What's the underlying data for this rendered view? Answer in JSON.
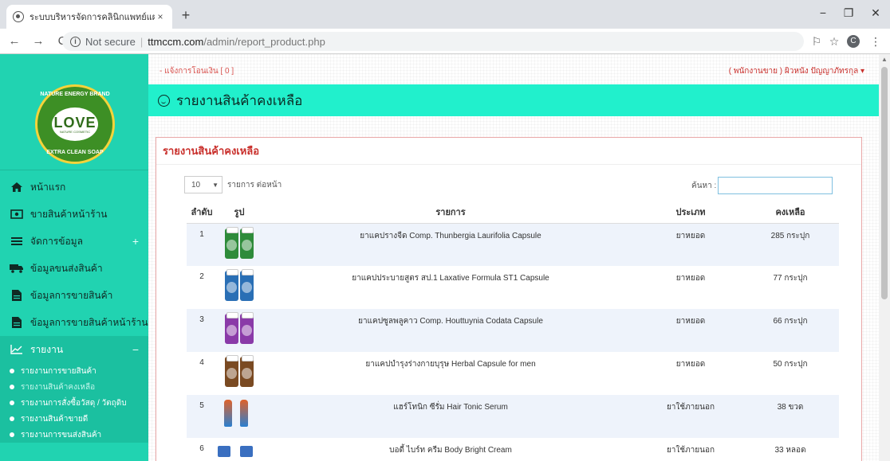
{
  "browser": {
    "tab_title": "ระบบบริหารจัดการคลินิกแพทย์แผนไทย",
    "tab_close": "×",
    "new_tab": "+",
    "minimize": "−",
    "maximize": "❐",
    "close": "✕",
    "back": "←",
    "forward": "→",
    "reload": "C",
    "not_secure": "Not secure",
    "url_domain": "ttmccm.com",
    "url_path": "/admin/report_product.php",
    "profile_initial": "C",
    "star": "☆",
    "translate": "⚐",
    "more": "⋮"
  },
  "sidebar": {
    "logo": {
      "top_text": "NATURE ENERGY BRAND",
      "brand": "LOVE",
      "sub": "NATURE COSMETIC",
      "bottom_text": "EXTRA CLEAN SOAP"
    },
    "items": [
      {
        "label": "หน้าแรก",
        "icon": "home-icon"
      },
      {
        "label": "ขายสินค้าหน้าร้าน",
        "icon": "cash-icon"
      },
      {
        "label": "จัดการข้อมูล",
        "icon": "list-icon",
        "toggle": "+"
      },
      {
        "label": "ข้อมูลขนส่งสินค้า",
        "icon": "truck-icon"
      },
      {
        "label": "ข้อมูลการขายสินค้า",
        "icon": "file-icon"
      },
      {
        "label": "ข้อมูลการขายสินค้าหน้าร้าน",
        "icon": "file-icon"
      },
      {
        "label": "รายงาน",
        "icon": "chart-icon",
        "toggle": "−"
      }
    ],
    "sub_items": [
      "รายงานการขายสินค้า",
      "รายงานสินค้าคงเหลือ",
      "รายงานการสั่งซื้อวัสดุ / วัตถุดิบ",
      "รายงานสินค้าขายดี",
      "รายงานการขนส่งสินค้า"
    ]
  },
  "topbar": {
    "notice": "- แจ้งการโอนเงิน [ 0 ]",
    "user": "( พนักงานขาย ) ผิวหนัง ปัญญาภัทรกุล ▾"
  },
  "page": {
    "header_title": "รายงานสินค้าคงเหลือ",
    "panel_title": "รายงานสินค้าคงเหลือ",
    "per_page_value": "10",
    "per_page_label": "รายการ ต่อหน้า",
    "search_label": "ค้นหา :",
    "search_value": ""
  },
  "table": {
    "headers": [
      "ลำดับ",
      "รูป",
      "รายการ",
      "ประเภท",
      "คงเหลือ"
    ],
    "rows": [
      {
        "no": "1",
        "name": "ยาแคปรางจืด Comp. Thunbergia Laurifolia Capsule",
        "type": "ยาหยอด",
        "stock": "285 กระปุก"
      },
      {
        "no": "2",
        "name": "ยาแคปประบายสูตร สป.1 Laxative Formula ST1 Capsule",
        "type": "ยาหยอด",
        "stock": "77 กระปุก"
      },
      {
        "no": "3",
        "name": "ยาแคปซูลพลูคาว Comp. Houttuynia Codata Capsule",
        "type": "ยาหยอด",
        "stock": "66 กระปุก"
      },
      {
        "no": "4",
        "name": "ยาแคปบำรุงร่างกายบุรุษ Herbal Capsule for men",
        "type": "ยาหยอด",
        "stock": "50 กระปุก"
      },
      {
        "no": "5",
        "name": "แฮร์โทนิก ซีรั่ม Hair Tonic Serum",
        "type": "ยาใช้ภายนอก",
        "stock": "38 ขวด"
      },
      {
        "no": "6",
        "name": "บอดี้ ไบร์ท ครีม  Body Bright Cream",
        "type": "ยาใช้ภายนอก",
        "stock": "33 หลอด"
      }
    ]
  }
}
